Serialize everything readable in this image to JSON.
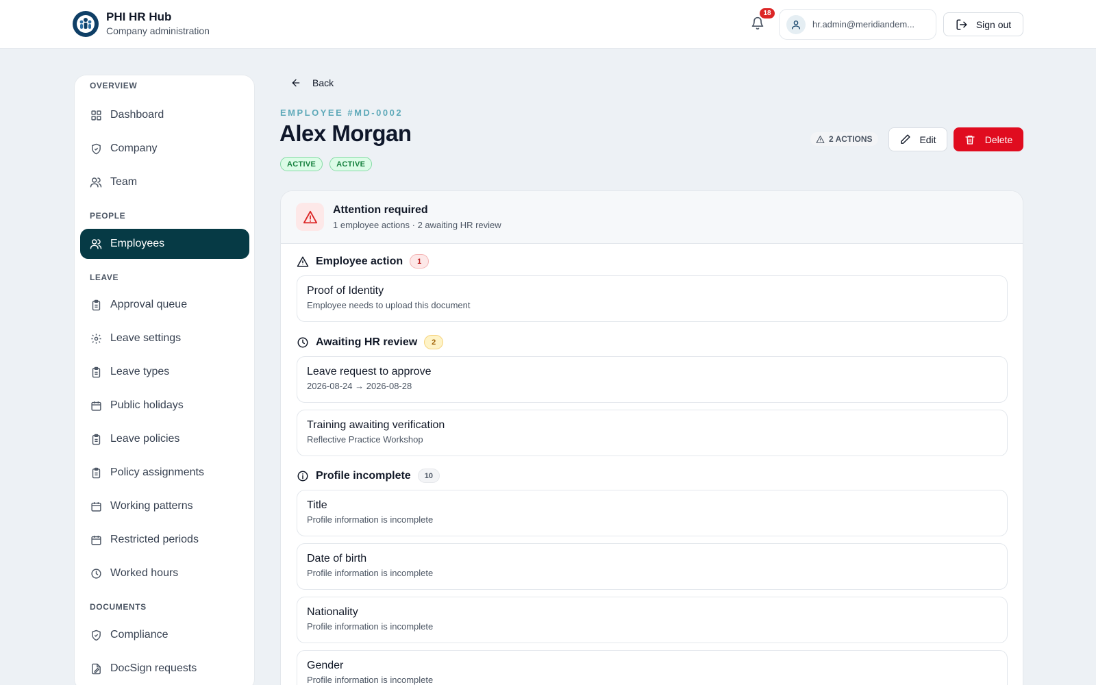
{
  "header": {
    "brand_title": "PHI HR Hub",
    "brand_subtitle": "Company administration",
    "notification_count": "18",
    "user_email": "hr.admin@meridiandem...",
    "sign_out_label": "Sign out"
  },
  "sidebar": {
    "sections": {
      "overview": "OVERVIEW",
      "people": "PEOPLE",
      "leave": "LEAVE",
      "documents": "DOCUMENTS"
    },
    "items": {
      "dashboard": "Dashboard",
      "company": "Company",
      "team": "Team",
      "employees": "Employees",
      "approval_queue": "Approval queue",
      "leave_settings": "Leave settings",
      "leave_types": "Leave types",
      "public_holidays": "Public holidays",
      "leave_policies": "Leave policies",
      "policy_assignments": "Policy assignments",
      "working_patterns": "Working patterns",
      "restricted_periods": "Restricted periods",
      "worked_hours": "Worked hours",
      "compliance": "Compliance",
      "docsign_requests": "DocSign requests"
    },
    "active_item": "Employees"
  },
  "page": {
    "back_label": "Back",
    "employee_id": "EMPLOYEE #MD-0002",
    "employee_name": "Alex Morgan",
    "status_1": "ACTIVE",
    "status_2": "ACTIVE",
    "actions_count_label": "2 ACTIONS",
    "edit_label": "Edit",
    "delete_label": "Delete"
  },
  "attention": {
    "title": "Attention required",
    "subtitle": "1 employee actions · 2 awaiting HR review",
    "groups": {
      "employee_action": {
        "label": "Employee action",
        "count": "1"
      },
      "awaiting_review": {
        "label": "Awaiting HR review",
        "count": "2"
      },
      "profile_incomplete": {
        "label": "Profile incomplete",
        "count": "10"
      }
    },
    "items": {
      "proof_identity": {
        "title": "Proof of Identity",
        "subtitle": "Employee needs to upload this document"
      },
      "leave_request": {
        "title": "Leave request to approve",
        "subtitle": "2026-08-24 → 2026-08-28"
      },
      "training": {
        "title": "Training awaiting verification",
        "subtitle": "Reflective Practice Workshop"
      },
      "title_field": {
        "title": "Title",
        "subtitle": "Profile information is incomplete"
      },
      "dob": {
        "title": "Date of birth",
        "subtitle": "Profile information is incomplete"
      },
      "nationality": {
        "title": "Nationality",
        "subtitle": "Profile information is incomplete"
      },
      "gender": {
        "title": "Gender",
        "subtitle": "Profile information is incomplete"
      }
    }
  },
  "colors": {
    "active_nav": "#063a45",
    "danger": "#e00c1f",
    "accent_teal": "#5ea9b9",
    "status_green": "#15803d"
  }
}
